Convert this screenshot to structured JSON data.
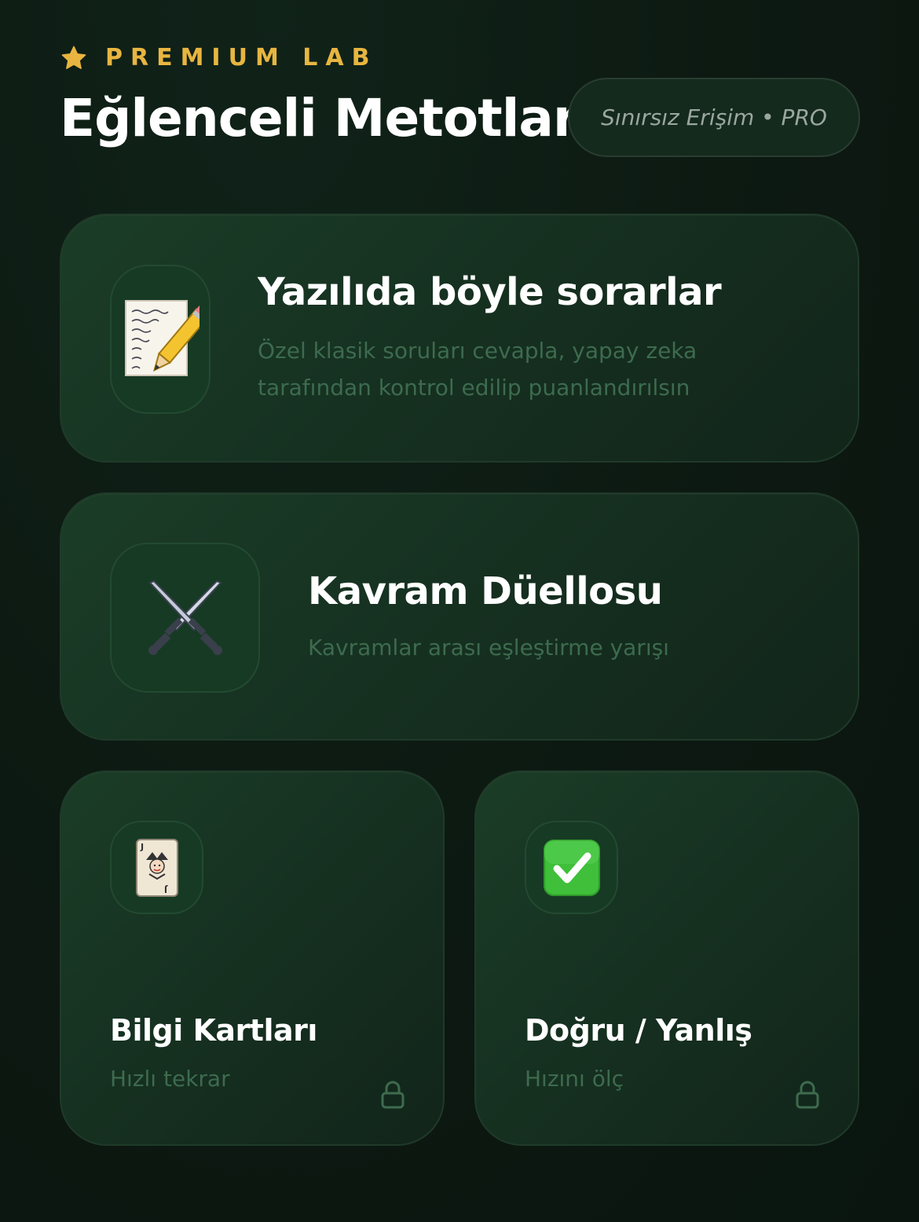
{
  "header": {
    "eyebrow": "PREMIUM LAB",
    "title": "Eğlenceli Metotlar",
    "access_badge": "Sınırsız Erişim • PRO"
  },
  "cards": [
    {
      "title": "Yazılıda böyle sorarlar",
      "description": "Özel klasik soruları cevapla, yapay zeka tarafından kontrol edilip puanlandırılsın",
      "icon": "memo-icon",
      "locked": false
    },
    {
      "title": "Kavram Düellosu",
      "description": "Kavramlar arası eşleştirme yarışı",
      "icon": "crossed-swords-icon",
      "locked": false
    },
    {
      "title": "Bilgi Kartları",
      "description": "Hızlı tekrar",
      "icon": "joker-card-icon",
      "locked": true
    },
    {
      "title": "Doğru / Yanlış",
      "description": "Hızını ölç",
      "icon": "check-mark-icon",
      "locked": true
    }
  ],
  "colors": {
    "background": "#0c1811",
    "accent_gold": "#e8b540",
    "card_green": "#173a24",
    "muted_text": "#3d6b4e"
  }
}
